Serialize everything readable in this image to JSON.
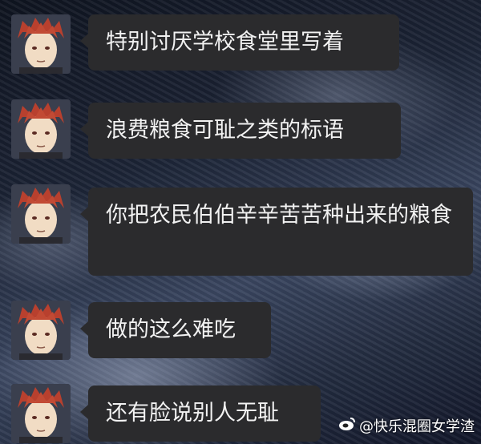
{
  "messages": [
    {
      "text": "特别讨厌学校食堂里写着"
    },
    {
      "text": "浪费粮食可耻之类的标语"
    },
    {
      "text": "你把农民伯伯辛辛苦苦种出来的粮食"
    },
    {
      "text": "做的这么难吃"
    },
    {
      "text": "还有脸说别人无耻"
    }
  ],
  "watermark": {
    "handle": "@快乐混圈女学渣",
    "icon": "weibo-icon"
  }
}
